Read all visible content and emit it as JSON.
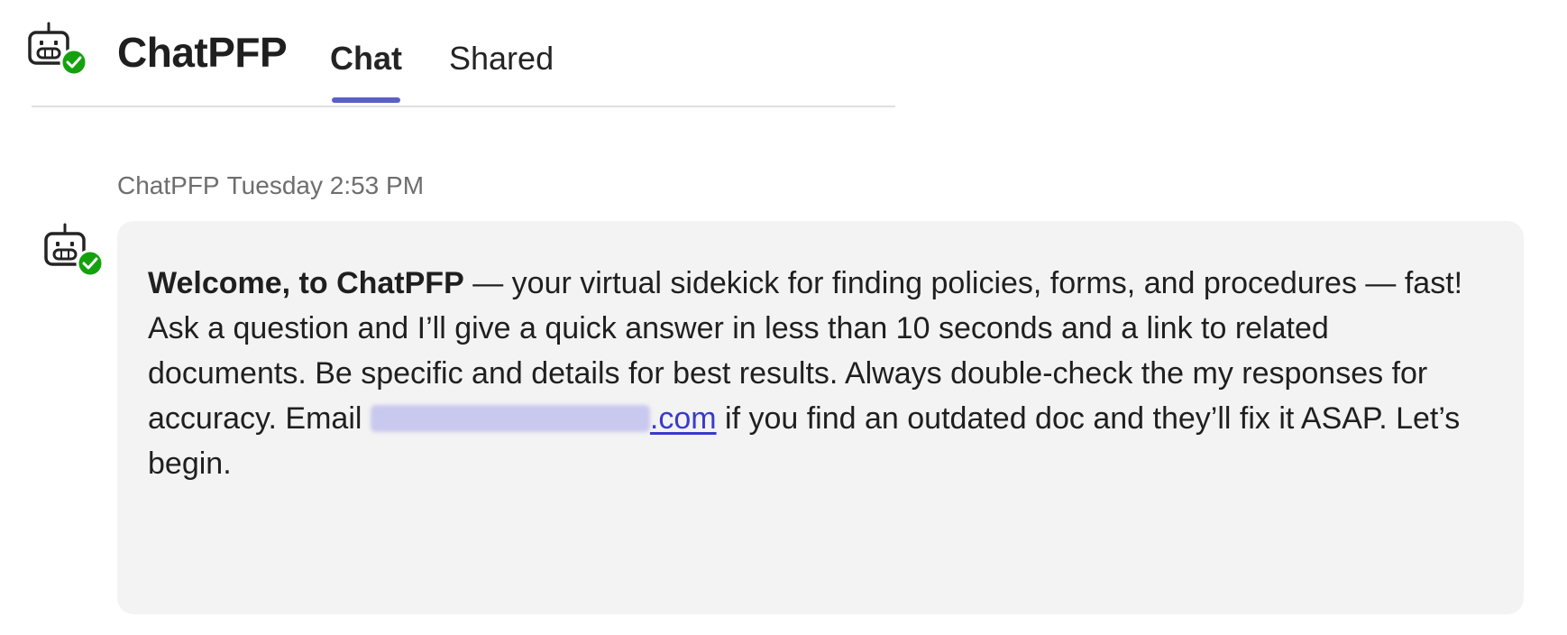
{
  "header": {
    "app_title": "ChatPFP",
    "avatar_icon": "robot-icon",
    "status_icon": "check-icon",
    "status_color": "#13a10e",
    "tabs": [
      {
        "label": "Chat",
        "active": true
      },
      {
        "label": "Shared",
        "active": false
      }
    ],
    "accent_color": "#5b5fc7"
  },
  "message": {
    "sender": "ChatPFP",
    "timestamp": "Tuesday 2:53 PM",
    "bubble_color": "#f3f3f3",
    "greeting_bold": "Welcome, to ChatPFP",
    "body_part1": " — your virtual sidekick for finding policies, forms, and procedures — fast! Ask a question and I’ll give a quick answer in less than 10 seconds and a link to related documents. Be specific and details for best results.  Always double-check the my responses for accuracy. Email ",
    "email_visible_suffix": ".com",
    "body_part2": " if you find an outdated doc and they’ll fix it ASAP. Let’s begin."
  }
}
